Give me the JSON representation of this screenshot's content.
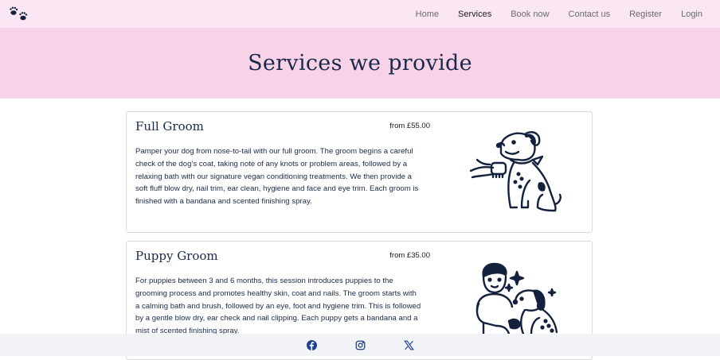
{
  "nav": {
    "links": [
      {
        "label": "Home"
      },
      {
        "label": "Services"
      },
      {
        "label": "Book now"
      },
      {
        "label": "Contact us"
      },
      {
        "label": "Register"
      },
      {
        "label": "Login"
      }
    ],
    "active_index": 1
  },
  "hero": {
    "title": "Services we provide"
  },
  "services": [
    {
      "title": "Full Groom",
      "price": "from £55.00",
      "description": "Pamper your dog from nose-to-tail with our full groom. The groom begins a careful check of the dog’s coat, taking note of any knots or problem areas, followed by a relaxing bath with our signature vegan conditioning treatments. We then provide a soft fluff blow dry, nail trim, ear clean, hygiene and face and eye trim. Each groom is finished with a bandana and scented finishing spray.",
      "illustration": "dog-being-brushed-icon"
    },
    {
      "title": "Puppy Groom",
      "price": "from £35.00",
      "description": "For puppies between 3 and 6 months, this session introduces puppies to the grooming process and promotes healthy skin, coat and nails. The groom starts with a calming bath and brush, followed by an eye, foot and hygiene trim. This is followed by a gentle blow dry, ear check and nail clipping. Each puppy gets a bandana and a mist of scented finishing spray.",
      "illustration": "boy-with-puppy-icon"
    }
  ],
  "footer": {
    "icons": [
      "facebook-icon",
      "instagram-icon",
      "x-twitter-icon"
    ]
  },
  "colors": {
    "navbar_bg": "#fbe7f3",
    "hero_bg": "#f8d2e7",
    "text": "#1b2a4a",
    "footer_bg": "#f1f3f6"
  }
}
